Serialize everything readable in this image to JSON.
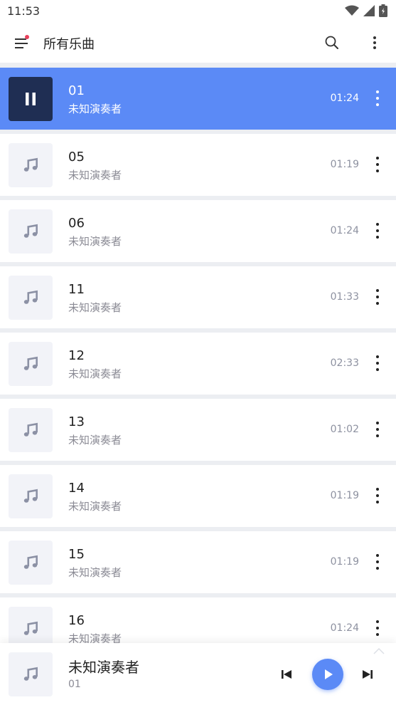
{
  "status": {
    "time": "11:53"
  },
  "appbar": {
    "title": "所有乐曲"
  },
  "colors": {
    "accent": "#5b8af6",
    "active_thumb": "#1f2e53",
    "notification_dot": "#e8405b"
  },
  "tracks": [
    {
      "name": "01",
      "artist": "未知演奏者",
      "duration": "01:24",
      "playing": true
    },
    {
      "name": "05",
      "artist": "未知演奏者",
      "duration": "01:19"
    },
    {
      "name": "06",
      "artist": "未知演奏者",
      "duration": "01:24"
    },
    {
      "name": "11",
      "artist": "未知演奏者",
      "duration": "01:33"
    },
    {
      "name": "12",
      "artist": "未知演奏者",
      "duration": "02:33"
    },
    {
      "name": "13",
      "artist": "未知演奏者",
      "duration": "01:02"
    },
    {
      "name": "14",
      "artist": "未知演奏者",
      "duration": "01:19"
    },
    {
      "name": "15",
      "artist": "未知演奏者",
      "duration": "01:19"
    },
    {
      "name": "16",
      "artist": "未知演奏者",
      "duration": "01:24"
    }
  ],
  "player": {
    "title": "未知演奏者",
    "subtitle": "01"
  },
  "icons": {
    "menu": "menu-icon",
    "search": "search-icon",
    "more": "more-vert-icon",
    "music": "music-note-icon",
    "pause": "pause-icon",
    "play": "play-icon",
    "prev": "skip-previous-icon",
    "next": "skip-next-icon",
    "wifi": "wifi-icon",
    "signal": "signal-icon",
    "battery": "battery-icon"
  }
}
